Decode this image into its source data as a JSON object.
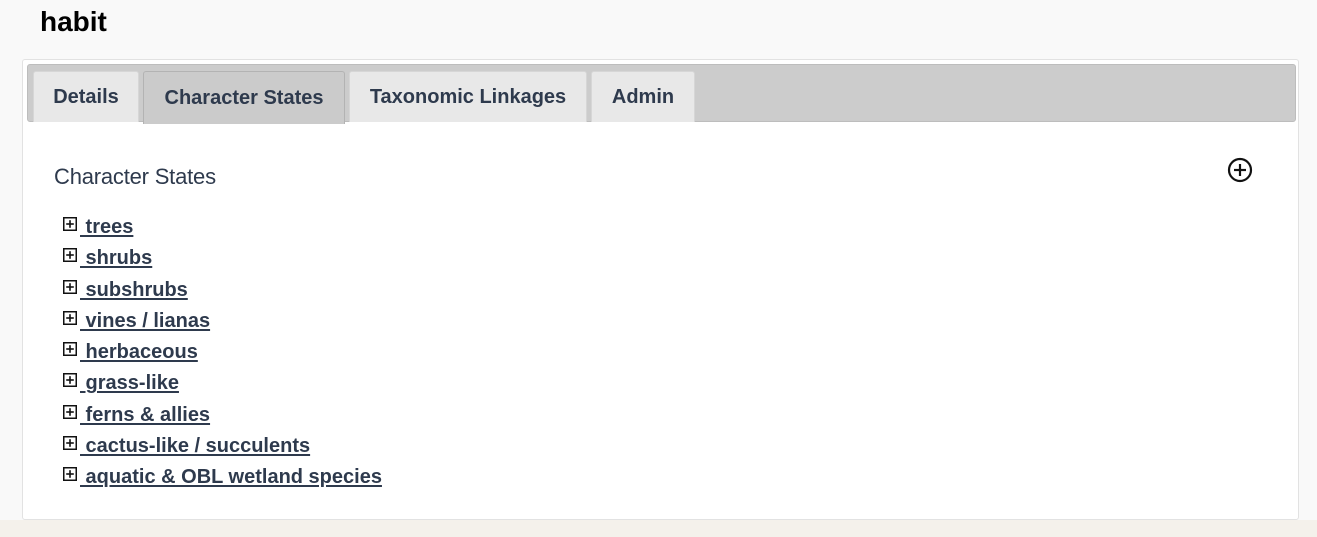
{
  "page": {
    "title": "habit"
  },
  "tabs": [
    {
      "label": "Details",
      "active": false
    },
    {
      "label": "Character States",
      "active": true
    },
    {
      "label": "Taxonomic Linkages",
      "active": false
    },
    {
      "label": "Admin",
      "active": false
    }
  ],
  "section": {
    "title": "Character States",
    "add_icon": "circle-plus-icon"
  },
  "character_states": [
    {
      "label": " trees",
      "icon": "expand-plus-icon"
    },
    {
      "label": " shrubs",
      "icon": "expand-plus-icon"
    },
    {
      "label": " subshrubs",
      "icon": "expand-plus-icon"
    },
    {
      "label": " vines / lianas",
      "icon": "expand-plus-icon"
    },
    {
      "label": " herbaceous",
      "icon": "expand-plus-icon"
    },
    {
      "label": " grass-like",
      "icon": "expand-plus-icon"
    },
    {
      "label": " ferns & allies",
      "icon": "expand-plus-icon"
    },
    {
      "label": " cactus-like / succulents",
      "icon": "expand-plus-icon"
    },
    {
      "label": " aquatic & OBL wetland species",
      "icon": "expand-plus-icon"
    }
  ],
  "colors": {
    "text_primary": "#2e3a4d",
    "tab_bar": "#cccccc",
    "tab_inactive": "#e8e8e8",
    "tab_active": "#cbcbcb"
  }
}
